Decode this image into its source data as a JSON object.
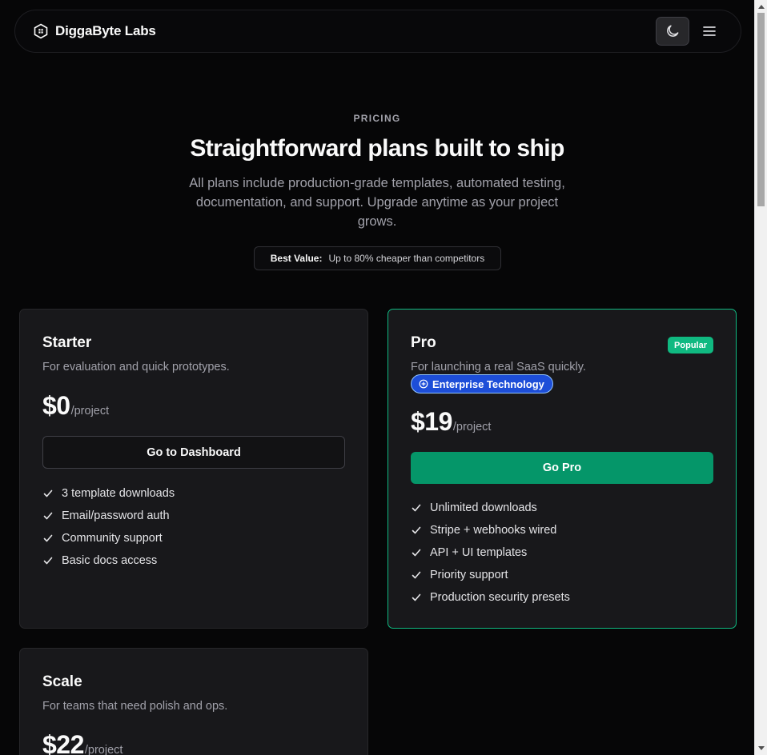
{
  "header": {
    "brand": "DiggaByte Labs",
    "theme_toggle_icon": "moon-icon",
    "menu_icon": "hamburger-menu-icon"
  },
  "hero": {
    "eyebrow": "PRICING",
    "title": "Straightforward plans built to ship",
    "subtitle": "All plans include production-grade templates, automated testing, documentation, and support. Upgrade anytime as your project grows.",
    "badge_label": "Best Value:",
    "badge_text": "Up to 80% cheaper than competitors"
  },
  "plans": [
    {
      "name": "Starter",
      "description": "For evaluation and quick prototypes.",
      "price": "$0",
      "unit": "/project",
      "cta": "Go to Dashboard",
      "features": [
        "3 template downloads",
        "Email/password auth",
        "Community support",
        "Basic docs access"
      ]
    },
    {
      "name": "Pro",
      "badge": "Popular",
      "description": "For launching a real SaaS quickly.",
      "tag": "Enterprise Technology",
      "price": "$19",
      "unit": "/project",
      "cta": "Go Pro",
      "features": [
        "Unlimited downloads",
        "Stripe + webhooks wired",
        "API + UI templates",
        "Priority support",
        "Production security presets"
      ]
    },
    {
      "name": "Scale",
      "description": "For teams that need polish and ops.",
      "price": "$22",
      "unit": "/project"
    }
  ],
  "colors": {
    "accent_green": "#10b981",
    "button_green": "#059669",
    "enterprise_blue": "#1d4ed8",
    "card_bg": "#18181b",
    "page_bg": "#060607"
  }
}
